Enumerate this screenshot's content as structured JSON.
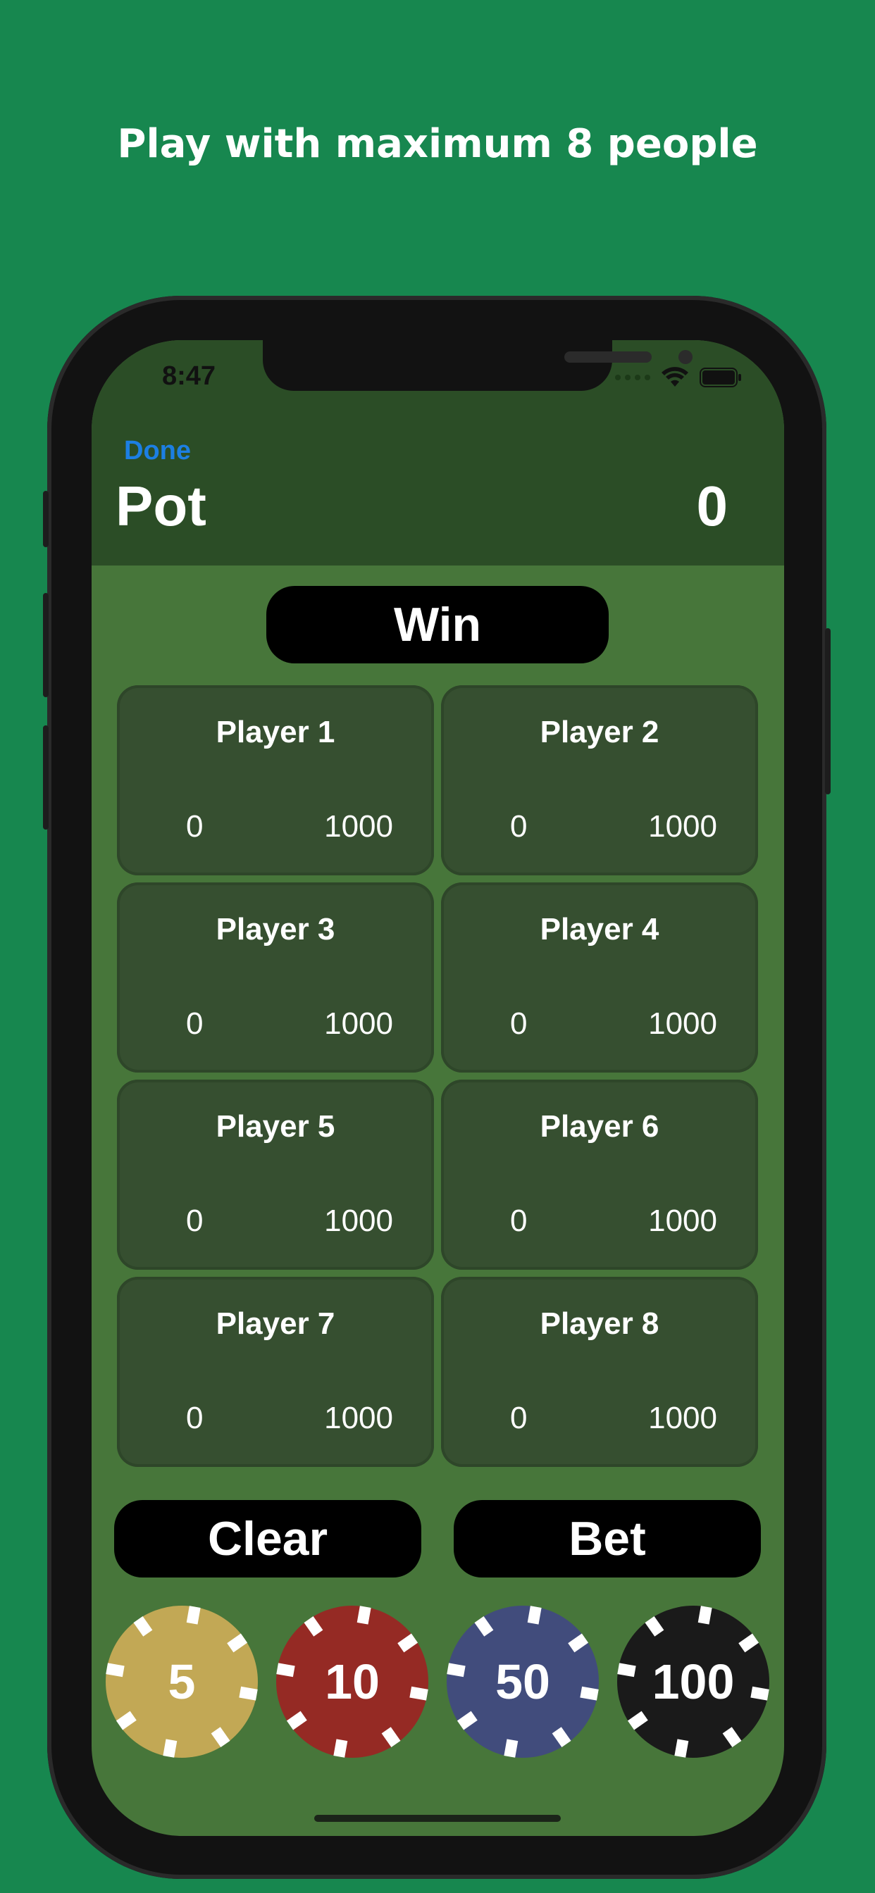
{
  "headline": "Play with maximum 8 people",
  "status_bar": {
    "time": "8:47"
  },
  "nav": {
    "done_label": "Done"
  },
  "pot": {
    "label": "Pot",
    "value": "0"
  },
  "win_label": "Win",
  "players": [
    {
      "name": "Player 1",
      "bet": "0",
      "stack": "1000"
    },
    {
      "name": "Player 2",
      "bet": "0",
      "stack": "1000"
    },
    {
      "name": "Player 3",
      "bet": "0",
      "stack": "1000"
    },
    {
      "name": "Player 4",
      "bet": "0",
      "stack": "1000"
    },
    {
      "name": "Player 5",
      "bet": "0",
      "stack": "1000"
    },
    {
      "name": "Player 6",
      "bet": "0",
      "stack": "1000"
    },
    {
      "name": "Player 7",
      "bet": "0",
      "stack": "1000"
    },
    {
      "name": "Player 8",
      "bet": "0",
      "stack": "1000"
    }
  ],
  "actions": {
    "clear_label": "Clear",
    "bet_label": "Bet"
  },
  "chips": [
    {
      "value": "5",
      "color": "#c2a855"
    },
    {
      "value": "10",
      "color": "#952a24"
    },
    {
      "value": "50",
      "color": "#414c7c"
    },
    {
      "value": "100",
      "color": "#1a1a1a"
    }
  ],
  "colors": {
    "background": "#17874f",
    "table": "#47763a",
    "header": "#2b4d26",
    "card": "#364f30",
    "accent": "#1c7fe3"
  },
  "icons": {
    "wifi": "wifi-icon",
    "battery": "battery-icon",
    "signal": "signal-dots-icon"
  }
}
